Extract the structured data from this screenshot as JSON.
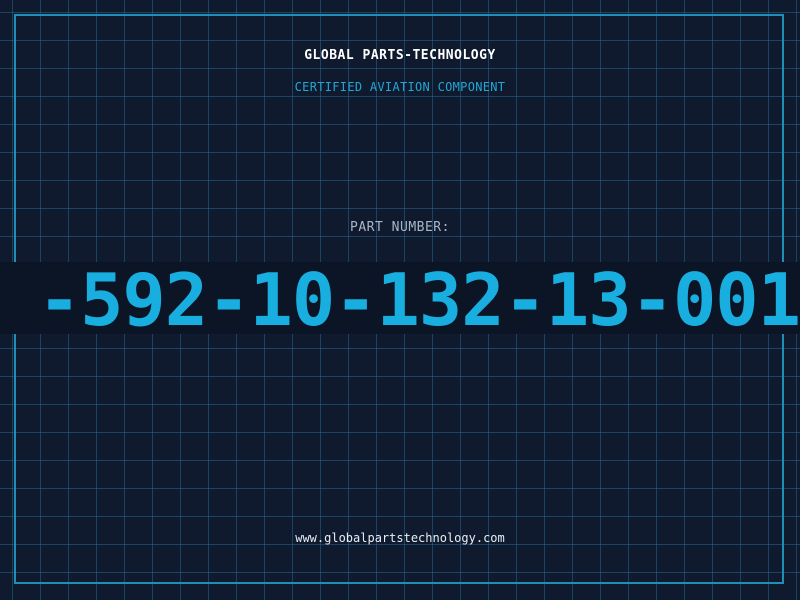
{
  "header": {
    "company": "GLOBAL PARTS-TECHNOLOGY",
    "subtitle": "CERTIFIED AVIATION COMPONENT"
  },
  "part": {
    "label": "PART NUMBER:",
    "number": "-592-10-132-13-001"
  },
  "footer": {
    "website": "www.globalpartstechnology.com"
  },
  "colors": {
    "background": "#0f1a2e",
    "grid": "#2878a0",
    "accent": "#19aee0",
    "frame": "#1f8fb5"
  }
}
